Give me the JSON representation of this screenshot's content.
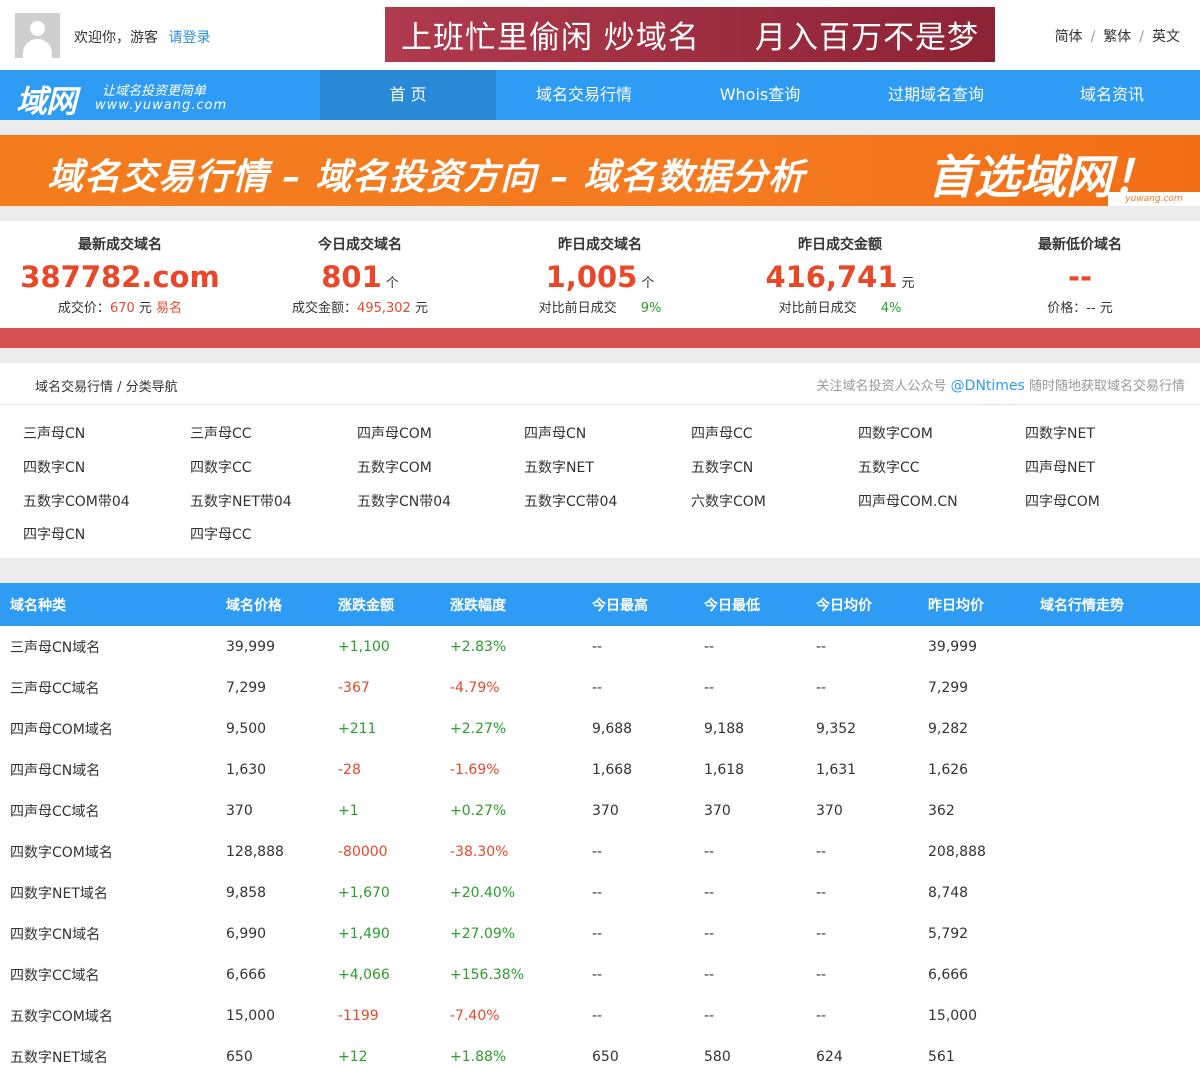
{
  "topbar": {
    "welcome": "欢迎你，游客",
    "login": "请登录",
    "banner_left": "上班忙里偷闲 炒域名",
    "banner_right": "月入百万不是梦",
    "languages": [
      "简体",
      "繁体",
      "英文"
    ]
  },
  "nav": {
    "logo_mark": "域网",
    "logo_slogan": "让域名投资更简单",
    "logo_url": "www.yuwang.com",
    "items": [
      "首 页",
      "域名交易行情",
      "Whois查询",
      "过期域名查询",
      "域名资讯"
    ],
    "active_index": 0
  },
  "banner": {
    "text": "域名交易行情 – 域名投资方向 – 域名数据分析",
    "highlight": "首选域网！",
    "watermark": "yuwang.com"
  },
  "stats": [
    {
      "label": "最新成交域名",
      "value": "387782.com",
      "unit": "",
      "sub_prefix": "成交价：",
      "sub_value": "670",
      "sub_suffix": " 元",
      "sub_extra": "易名"
    },
    {
      "label": "今日成交域名",
      "value": "801",
      "unit": "个",
      "sub_prefix": "成交金额：",
      "sub_value": "495,302",
      "sub_suffix": " 元",
      "sub_extra": ""
    },
    {
      "label": "昨日成交域名",
      "value": "1,005",
      "unit": "个",
      "sub_prefix": "对比前日成交",
      "sub_value": "",
      "sub_suffix": "",
      "sub_extra": "9%"
    },
    {
      "label": "昨日成交金额",
      "value": "416,741",
      "unit": "元",
      "sub_prefix": "对比前日成交",
      "sub_value": "",
      "sub_suffix": "",
      "sub_extra": "4%"
    },
    {
      "label": "最新低价域名",
      "value": "--",
      "unit": "",
      "sub_prefix": "价格：-- 元",
      "sub_value": "",
      "sub_suffix": "",
      "sub_extra": ""
    }
  ],
  "category": {
    "breadcrumb": "域名交易行情 / 分类导航",
    "follow_prefix": "关注域名投资人公众号 ",
    "follow_handle": "@DNtimes",
    "follow_suffix": " 随时随地获取域名交易行情",
    "links": [
      "三声母CN",
      "三声母CC",
      "四声母COM",
      "四声母CN",
      "四声母CC",
      "四数字COM",
      "四数字NET",
      "四数字CN",
      "四数字CC",
      "五数字COM",
      "五数字NET",
      "五数字CN",
      "五数字CC",
      "四声母NET",
      "五数字COM带04",
      "五数字NET带04",
      "五数字CN带04",
      "五数字CC带04",
      "六数字COM",
      "四声母COM.CN",
      "四字母COM",
      "四字母CN",
      "四字母CC"
    ]
  },
  "table": {
    "headers": [
      "域名种类",
      "域名价格",
      "涨跌金额",
      "涨跌幅度",
      "今日最高",
      "今日最低",
      "今日均价",
      "昨日均价",
      "域名行情走势"
    ],
    "rows": [
      [
        "三声母CN域名",
        "39,999",
        "+1,100",
        "+2.83%",
        "--",
        "--",
        "--",
        "39,999",
        ""
      ],
      [
        "三声母CC域名",
        "7,299",
        "-367",
        "-4.79%",
        "--",
        "--",
        "--",
        "7,299",
        ""
      ],
      [
        "四声母COM域名",
        "9,500",
        "+211",
        "+2.27%",
        "9,688",
        "9,188",
        "9,352",
        "9,282",
        ""
      ],
      [
        "四声母CN域名",
        "1,630",
        "-28",
        "-1.69%",
        "1,668",
        "1,618",
        "1,631",
        "1,626",
        ""
      ],
      [
        "四声母CC域名",
        "370",
        "+1",
        "+0.27%",
        "370",
        "370",
        "370",
        "362",
        ""
      ],
      [
        "四数字COM域名",
        "128,888",
        "-80000",
        "-38.30%",
        "--",
        "--",
        "--",
        "208,888",
        ""
      ],
      [
        "四数字NET域名",
        "9,858",
        "+1,670",
        "+20.40%",
        "--",
        "--",
        "--",
        "8,748",
        ""
      ],
      [
        "四数字CN域名",
        "6,990",
        "+1,490",
        "+27.09%",
        "--",
        "--",
        "--",
        "5,792",
        ""
      ],
      [
        "四数字CC域名",
        "6,666",
        "+4,066",
        "+156.38%",
        "--",
        "--",
        "--",
        "6,666",
        ""
      ],
      [
        "五数字COM域名",
        "15,000",
        "-1199",
        "-7.40%",
        "--",
        "--",
        "--",
        "15,000",
        ""
      ],
      [
        "五数字NET域名",
        "650",
        "+12",
        "+1.88%",
        "650",
        "580",
        "624",
        "561",
        ""
      ]
    ]
  },
  "colors": {
    "primary": "#2e9bf4",
    "nav_active": "#2a89d6",
    "banner_orange": "#f57a20",
    "red": "#e8472a",
    "green": "#2aa02a",
    "redbar": "#d55050"
  }
}
